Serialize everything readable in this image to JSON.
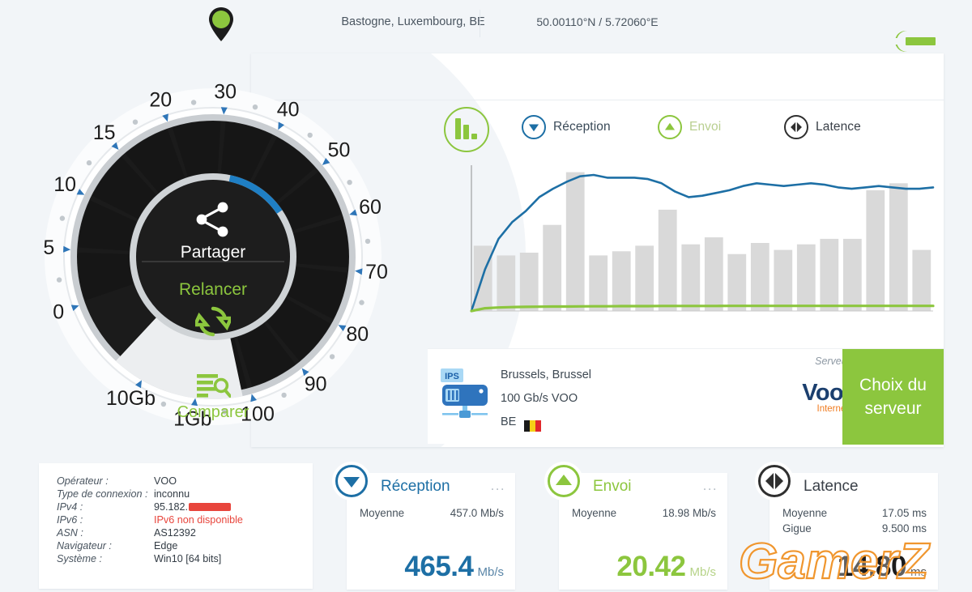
{
  "colors": {
    "green": "#8cc63e",
    "blue": "#1d6fa5",
    "dark": "#2f2f2f",
    "bg": "#f2f5f8",
    "orange": "#f07c20"
  },
  "toolbar": {
    "settings_icon": "wrench-icon"
  },
  "location": {
    "pin_icon": "map-pin-icon",
    "place": "Bastogne, Luxembourg, BE",
    "coordinates": "50.00110°N / 5.72060°E"
  },
  "legend": {
    "chart_icon": "bar-chart-icon",
    "items": [
      {
        "label": "Réception",
        "icon": "download-arrow-icon",
        "color": "#1d6fa5"
      },
      {
        "label": "Envoi",
        "icon": "upload-arrow-icon",
        "color": "#8cc63e"
      },
      {
        "label": "Latence",
        "icon": "latency-arrows-icon",
        "color": "#2f2f2f"
      }
    ]
  },
  "chart_data": {
    "type": "line",
    "title": "",
    "xlabel": "",
    "ylabel": "",
    "grid": false,
    "legend_position": "top",
    "x": [
      0,
      1,
      2,
      3,
      4,
      5,
      6,
      7,
      8,
      9,
      10,
      11,
      12,
      13,
      14,
      15,
      16,
      17,
      18,
      19,
      20
    ],
    "bars": {
      "name": "Latence",
      "color": "#d9d9d9",
      "values": [
        47,
        40,
        42,
        62,
        100,
        40,
        43,
        47,
        73,
        48,
        53,
        41,
        49,
        44,
        48,
        52,
        52,
        87,
        92,
        44
      ]
    },
    "series": [
      {
        "name": "Réception",
        "color": "#1d6fa5",
        "values": [
          0,
          30,
          52,
          64,
          72,
          82,
          88,
          93,
          97,
          98,
          96,
          96,
          96,
          95,
          92,
          86,
          82,
          83,
          85,
          87,
          90,
          92,
          91,
          90,
          91,
          92,
          91,
          89,
          88,
          89,
          90,
          89,
          88,
          88,
          89
        ]
      },
      {
        "name": "Envoi",
        "color": "#8cc63e",
        "values": [
          0,
          2,
          2.5,
          2.8,
          3,
          3.1,
          3.2,
          3.2,
          3.3,
          3.4,
          3.4,
          3.5,
          3.5,
          3.5,
          3.6,
          3.6,
          3.6,
          3.6,
          3.6,
          3.7,
          3.7,
          3.7,
          3.7,
          3.7,
          3.7,
          3.7,
          3.7,
          3.7,
          3.7,
          3.7,
          3.7,
          3.7,
          3.7,
          3.7,
          3.7
        ]
      }
    ],
    "ylim": [
      0,
      105
    ]
  },
  "gauge": {
    "ticks": [
      "0",
      "5",
      "10",
      "15",
      "20",
      "30",
      "40",
      "50",
      "60",
      "70",
      "80",
      "90",
      "100",
      "1Gb",
      "10Gb"
    ],
    "share_label": "Partager",
    "share_icon": "share-icon",
    "restart_label": "Relancer",
    "restart_icon": "refresh-icon",
    "compare_label": "Comparer",
    "compare_icon": "compare-list-icon",
    "progress_percent": 74
  },
  "server": {
    "icon": "server-ips-icon",
    "badge": "IPS",
    "city": "Brussels, Brussel",
    "speed": "100 Gb/s VOO",
    "country": "BE",
    "flag_icon": "belgium-flag-icon",
    "serveur_label": "Serveur",
    "logo_name": "Voob.",
    "logo_sub": "Internet",
    "button_line1": "Choix du",
    "button_line2": "serveur"
  },
  "info": {
    "rows": [
      {
        "key": "Opérateur :",
        "value": "VOO",
        "redacted": false,
        "red": false
      },
      {
        "key": "Type de connexion :",
        "value": "inconnu",
        "redacted": false,
        "red": false
      },
      {
        "key": "IPv4 :",
        "value": "95.182.",
        "redacted": true,
        "red": false
      },
      {
        "key": "IPv6 :",
        "value": "IPv6 non disponible",
        "redacted": false,
        "red": true
      },
      {
        "key": "ASN :",
        "value": "AS12392",
        "redacted": false,
        "red": false
      },
      {
        "key": "Navigateur :",
        "value": "Edge",
        "redacted": false,
        "red": false
      },
      {
        "key": "Système :",
        "value": "Win10 [64 bits]",
        "redacted": false,
        "red": false
      }
    ]
  },
  "stats": [
    {
      "title": "Réception",
      "icon": "download-arrow-icon",
      "color": "#1d6fa5",
      "menu": "...",
      "rows": [
        {
          "label": "Moyenne",
          "value": "457.0 Mb/s"
        }
      ],
      "value": "465.4",
      "unit": "Mb/s"
    },
    {
      "title": "Envoi",
      "icon": "upload-arrow-icon",
      "color": "#8cc63e",
      "menu": "...",
      "rows": [
        {
          "label": "Moyenne",
          "value": "18.98 Mb/s"
        }
      ],
      "value": "20.42",
      "unit": "Mb/s"
    },
    {
      "title": "Latence",
      "icon": "latency-arrows-icon",
      "color": "#2f2f2f",
      "menu": "",
      "rows": [
        {
          "label": "Moyenne",
          "value": "17.05 ms"
        },
        {
          "label": "Gigue",
          "value": "9.500 ms"
        }
      ],
      "value": "14.80",
      "unit": "ms"
    }
  ],
  "watermark": {
    "text": "GamerZ"
  }
}
